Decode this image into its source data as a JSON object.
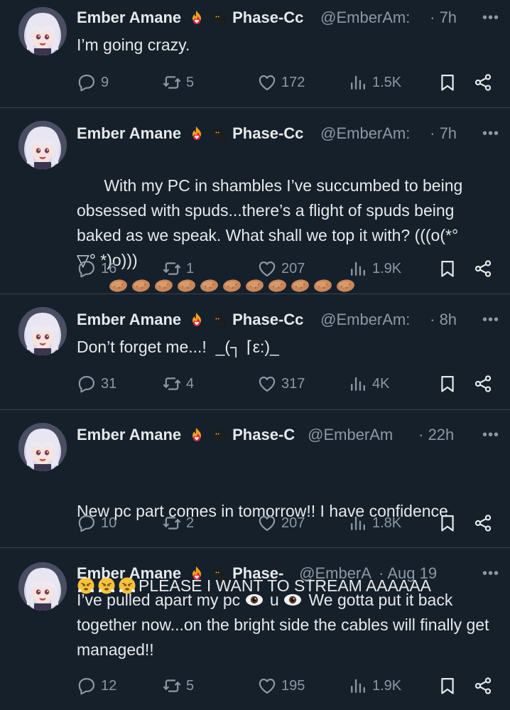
{
  "author": {
    "name": "Ember Amane",
    "badge_icons": [
      "fire-heart-icon",
      "black-cat-icon"
    ]
  },
  "colors": {
    "background": "#15202b",
    "text": "#e7e9ea",
    "muted": "#8b98a5",
    "divider": "#38444d"
  },
  "tweets": [
    {
      "affiliation": "Phase-Cc",
      "handle": "@EmberAm:",
      "time": "· 7h",
      "text": "I’m going crazy.",
      "replies": "9",
      "reposts": "5",
      "likes": "172",
      "views": "1.5K"
    },
    {
      "affiliation": "Phase-Cc",
      "handle": "@EmberAm:",
      "time": "· 7h",
      "text": "With my PC in shambles I’ve succumbed to being obsessed with spuds...there’s a flight of spuds being baked as we speak. What shall we top it with? (((o(*°\n▽° *)o)))",
      "spud_count": 11,
      "replies": "16",
      "reposts": "1",
      "likes": "207",
      "views": "1.9K"
    },
    {
      "affiliation": "Phase-Cc",
      "handle": "@EmberAm:",
      "time": "· 8h",
      "text": "Don’t forget me...!  _(┐ ⌈ε:)_",
      "replies": "31",
      "reposts": "4",
      "likes": "317",
      "views": "4K"
    },
    {
      "affiliation": "Phase-C",
      "handle": "@EmberAm",
      "time": "· 22h",
      "text_line1": "New pc part comes in tomorrow!! I have confidence",
      "text_line2": "PLEASE I WANT TO STREAM AAAAAA",
      "emoji_count": 3,
      "replies": "10",
      "reposts": "2",
      "likes": "207",
      "views": "1.8K"
    },
    {
      "affiliation": "Phase-",
      "handle": "@EmberA",
      "time": "· Aug 19",
      "text_a": "I’ve pulled apart my pc",
      "text_b": "u",
      "text_c": "We gotta put it back together now...on the bright side the cables will finally get managed!!",
      "replies": "12",
      "reposts": "5",
      "likes": "195",
      "views": "1.9K"
    }
  ]
}
